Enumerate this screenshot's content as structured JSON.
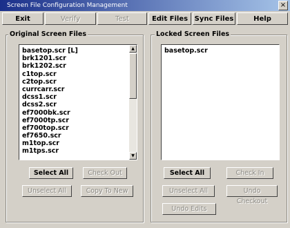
{
  "window": {
    "title": "Screen File Configuration Management",
    "close_glyph": "×"
  },
  "menu": {
    "exit": "Exit",
    "verify": "Verify",
    "test": "Test",
    "edit_files": "Edit Files",
    "sync_files": "Sync Files",
    "help": "Help"
  },
  "original": {
    "label": "Original Screen Files",
    "items": [
      "basetop.scr [L]",
      "brk1201.scr",
      "brk1202.scr",
      "c1top.scr",
      "c2top.scr",
      "currcarr.scr",
      "dcss1.scr",
      "dcss2.scr",
      "ef7000bk.scr",
      "ef7000tp.scr",
      "ef700top.scr",
      "ef7650.scr",
      "m1top.scr",
      "m1tps.scr"
    ],
    "buttons": {
      "select_all": "Select All",
      "check_out": "Check Out",
      "unselect_all": "Unselect All",
      "copy_to_new": "Copy To New"
    }
  },
  "locked": {
    "label": "Locked Screen Files",
    "items": [
      "basetop.scr"
    ],
    "buttons": {
      "select_all": "Select All",
      "check_in": "Check In",
      "unselect_all": "Unselect All",
      "undo_checkout": "Undo Checkout",
      "undo_edits": "Undo Edits"
    }
  }
}
